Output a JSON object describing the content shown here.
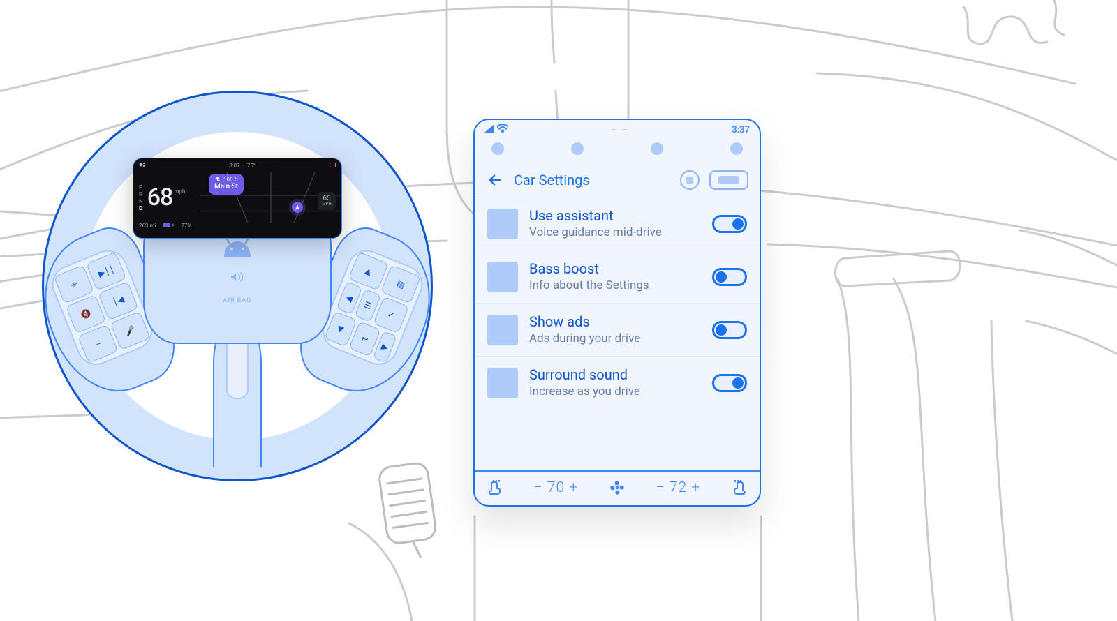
{
  "statusbar": {
    "time": "3:37"
  },
  "appbar": {
    "title": "Car Settings"
  },
  "settings": [
    {
      "title": "Use assistant",
      "subtitle": "Voice guidance mid-drive",
      "on": true
    },
    {
      "title": "Bass boost",
      "subtitle": "Info about the Settings",
      "on": false
    },
    {
      "title": "Show ads",
      "subtitle": "Ads during your drive",
      "on": false
    },
    {
      "title": "Surround sound",
      "subtitle": "Increase as you drive",
      "on": true
    }
  ],
  "climate": {
    "left_temp_label": "− 70 +",
    "right_temp_label": "− 72 +"
  },
  "cluster": {
    "clock": "8:07",
    "temperature": "75°",
    "gears": [
      "P",
      "R",
      "N",
      "D"
    ],
    "gear_active": "D",
    "speed_value": "68",
    "speed_unit": "mph",
    "nav_distance": "100 ft",
    "nav_street": "Main St",
    "limit_value": "65",
    "limit_unit": "MPH",
    "range_label": "263 mi",
    "battery_label": "77%",
    "footer_center": "",
    "footer_right": ""
  },
  "hub": {
    "airbag_label": "AIR BAG"
  },
  "wheel_buttons": {
    "left": [
      {
        "name": "volume-up",
        "glyph": "＋"
      },
      {
        "name": "play-pause",
        "glyph": "▶││"
      },
      {
        "name": "mute",
        "glyph": "🔇"
      },
      {
        "name": "prev-track",
        "glyph": "│◀"
      },
      {
        "name": "volume-down",
        "glyph": "－"
      },
      {
        "name": "voice",
        "glyph": "🎤"
      }
    ],
    "right": [
      {
        "name": "dpad-up",
        "glyph": "▲"
      },
      {
        "name": "app-menu",
        "glyph": "▤"
      },
      {
        "name": "dpad-left",
        "glyph": "◀"
      },
      {
        "name": "list",
        "glyph": "☰"
      },
      {
        "name": "confirm",
        "glyph": "✓"
      },
      {
        "name": "dpad-down",
        "glyph": "▼"
      },
      {
        "name": "back",
        "glyph": "↩"
      },
      {
        "name": "dpad-right",
        "glyph": "▶"
      }
    ]
  }
}
